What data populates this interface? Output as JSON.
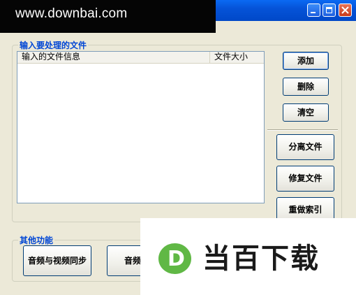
{
  "window": {
    "watermark": "www.downbai.com"
  },
  "input_group": {
    "legend": "输入要处理的文件",
    "columns": [
      "输入的文件信息",
      "文件大小"
    ]
  },
  "buttons": {
    "add": "添加",
    "delete": "删除",
    "clear": "清空",
    "split": "分离文件",
    "repair": "修复文件",
    "reindex": "重做索引"
  },
  "other_group": {
    "legend": "其他功能",
    "av_sync": "音频与视频同步",
    "av_second": "音频与视"
  },
  "logo": {
    "mark": "D",
    "text": "当百下载",
    "mark_color": "#60B845"
  }
}
